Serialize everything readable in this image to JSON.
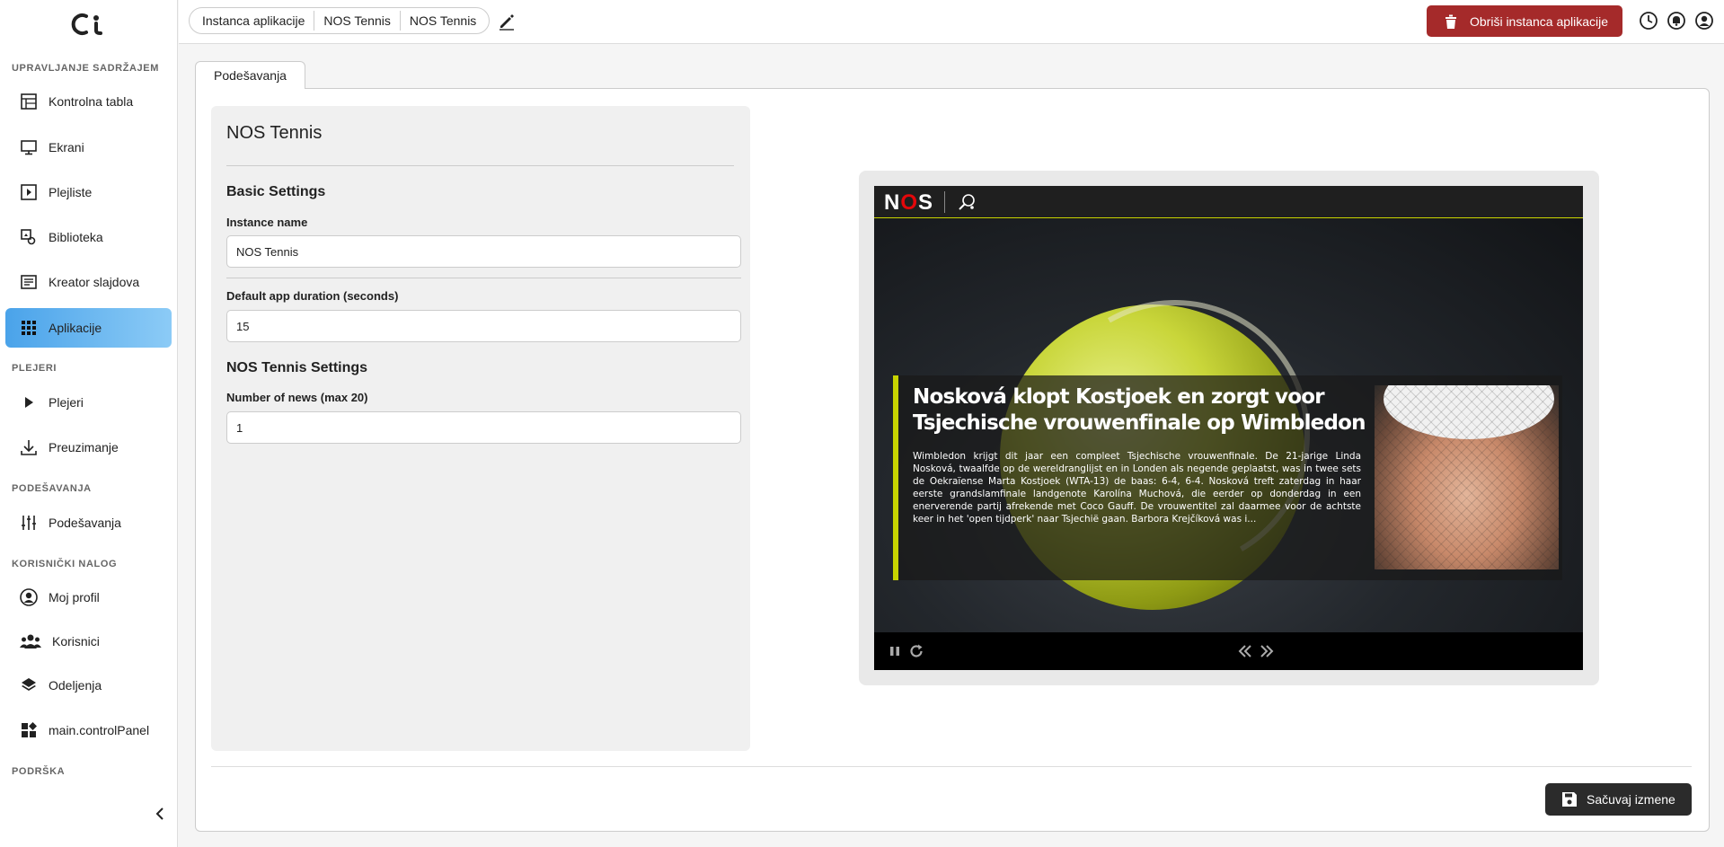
{
  "logo": {
    "text": "ci"
  },
  "sidebar": {
    "sections": [
      {
        "title": "UPRAVLJANJE SADRŽAJEM"
      },
      {
        "title": "PLEJERI"
      },
      {
        "title": "PODEŠAVANJA"
      },
      {
        "title": "KORISNIČKI NALOG"
      },
      {
        "title": "PODRŠKA"
      }
    ],
    "items": [
      {
        "label": "Kontrolna tabla",
        "icon": "dashboard-icon"
      },
      {
        "label": "Ekrani",
        "icon": "monitor-icon"
      },
      {
        "label": "Plejliste",
        "icon": "playlist-icon"
      },
      {
        "label": "Biblioteka",
        "icon": "library-icon"
      },
      {
        "label": "Kreator slajdova",
        "icon": "slide-icon"
      },
      {
        "label": "Aplikacije",
        "icon": "apps-grid-icon",
        "active": true
      },
      {
        "label": "Plejeri",
        "icon": "play-icon"
      },
      {
        "label": "Preuzimanje",
        "icon": "download-icon"
      },
      {
        "label": "Podešavanja",
        "icon": "sliders-icon"
      },
      {
        "label": "Moj profil",
        "icon": "profile-icon"
      },
      {
        "label": "Korisnici",
        "icon": "users-icon"
      },
      {
        "label": "Odeljenja",
        "icon": "layers-icon"
      },
      {
        "label": "main.controlPanel",
        "icon": "widgets-icon"
      }
    ]
  },
  "topbar": {
    "breadcrumb": [
      "Instanca aplikacije",
      "NOS Tennis",
      "NOS Tennis"
    ],
    "delete_label": "Obriši instanca aplikacije",
    "colors": {
      "delete": "#a52a2a"
    }
  },
  "tabs": [
    {
      "label": "Podešavanja"
    }
  ],
  "form": {
    "title": "NOS Tennis",
    "basic_heading": "Basic Settings",
    "instance_name_label": "Instance name",
    "instance_name_value": "NOS Tennis",
    "duration_label": "Default app duration (seconds)",
    "duration_value": "15",
    "app_heading": "NOS Tennis Settings",
    "news_count_label": "Number of news (max 20)",
    "news_count_value": "1"
  },
  "preview": {
    "brand": {
      "n": "N",
      "o": "O",
      "s": "S"
    },
    "headline": "Nosková klopt Kostjoek en zorgt voor Tsjechische vrouwenfinale op Wimbledon",
    "body": "Wimbledon krijgt dit jaar een compleet Tsjechische vrouwenfinale. De 21-jarige Linda Nosková, twaalfde op de wereldranglijst en in Londen als negende geplaatst, was in twee sets de Oekraïense Marta Kostjoek (WTA-13) de baas: 6-4, 6-4. Nosková treft zaterdag in haar eerste grandslamfinale landgenote Karolína Muchová, die eerder op donderdag in een enerverende partij afrekende met Coco Gauff. De vrouwentitel zal daarmee voor de achtste keer in het 'open tijdperk' naar Tsjechië gaan. Barbora Krejčíková was i...",
    "accent": "#c8d400"
  },
  "footer": {
    "save_label": "Sačuvaj izmene"
  }
}
